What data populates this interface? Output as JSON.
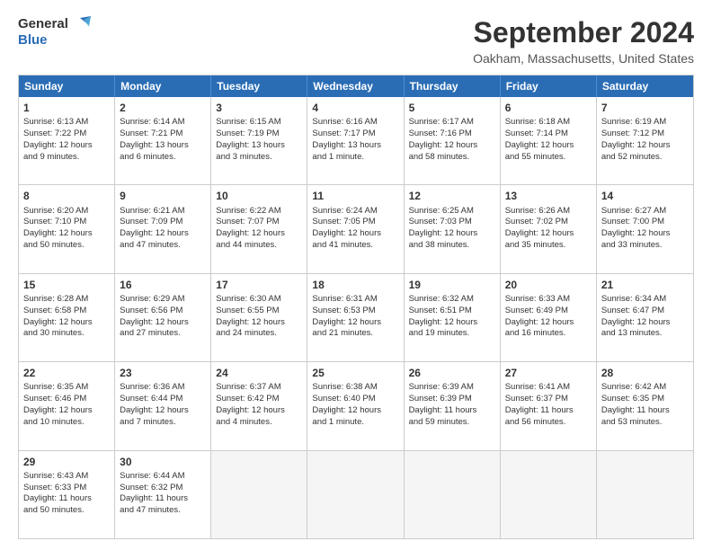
{
  "header": {
    "logo_line1": "General",
    "logo_line2": "Blue",
    "month": "September 2024",
    "location": "Oakham, Massachusetts, United States"
  },
  "weekdays": [
    "Sunday",
    "Monday",
    "Tuesday",
    "Wednesday",
    "Thursday",
    "Friday",
    "Saturday"
  ],
  "weeks": [
    [
      {
        "day": "1",
        "lines": [
          "Sunrise: 6:13 AM",
          "Sunset: 7:22 PM",
          "Daylight: 12 hours",
          "and 9 minutes."
        ]
      },
      {
        "day": "2",
        "lines": [
          "Sunrise: 6:14 AM",
          "Sunset: 7:21 PM",
          "Daylight: 13 hours",
          "and 6 minutes."
        ]
      },
      {
        "day": "3",
        "lines": [
          "Sunrise: 6:15 AM",
          "Sunset: 7:19 PM",
          "Daylight: 13 hours",
          "and 3 minutes."
        ]
      },
      {
        "day": "4",
        "lines": [
          "Sunrise: 6:16 AM",
          "Sunset: 7:17 PM",
          "Daylight: 13 hours",
          "and 1 minute."
        ]
      },
      {
        "day": "5",
        "lines": [
          "Sunrise: 6:17 AM",
          "Sunset: 7:16 PM",
          "Daylight: 12 hours",
          "and 58 minutes."
        ]
      },
      {
        "day": "6",
        "lines": [
          "Sunrise: 6:18 AM",
          "Sunset: 7:14 PM",
          "Daylight: 12 hours",
          "and 55 minutes."
        ]
      },
      {
        "day": "7",
        "lines": [
          "Sunrise: 6:19 AM",
          "Sunset: 7:12 PM",
          "Daylight: 12 hours",
          "and 52 minutes."
        ]
      }
    ],
    [
      {
        "day": "8",
        "lines": [
          "Sunrise: 6:20 AM",
          "Sunset: 7:10 PM",
          "Daylight: 12 hours",
          "and 50 minutes."
        ]
      },
      {
        "day": "9",
        "lines": [
          "Sunrise: 6:21 AM",
          "Sunset: 7:09 PM",
          "Daylight: 12 hours",
          "and 47 minutes."
        ]
      },
      {
        "day": "10",
        "lines": [
          "Sunrise: 6:22 AM",
          "Sunset: 7:07 PM",
          "Daylight: 12 hours",
          "and 44 minutes."
        ]
      },
      {
        "day": "11",
        "lines": [
          "Sunrise: 6:24 AM",
          "Sunset: 7:05 PM",
          "Daylight: 12 hours",
          "and 41 minutes."
        ]
      },
      {
        "day": "12",
        "lines": [
          "Sunrise: 6:25 AM",
          "Sunset: 7:03 PM",
          "Daylight: 12 hours",
          "and 38 minutes."
        ]
      },
      {
        "day": "13",
        "lines": [
          "Sunrise: 6:26 AM",
          "Sunset: 7:02 PM",
          "Daylight: 12 hours",
          "and 35 minutes."
        ]
      },
      {
        "day": "14",
        "lines": [
          "Sunrise: 6:27 AM",
          "Sunset: 7:00 PM",
          "Daylight: 12 hours",
          "and 33 minutes."
        ]
      }
    ],
    [
      {
        "day": "15",
        "lines": [
          "Sunrise: 6:28 AM",
          "Sunset: 6:58 PM",
          "Daylight: 12 hours",
          "and 30 minutes."
        ]
      },
      {
        "day": "16",
        "lines": [
          "Sunrise: 6:29 AM",
          "Sunset: 6:56 PM",
          "Daylight: 12 hours",
          "and 27 minutes."
        ]
      },
      {
        "day": "17",
        "lines": [
          "Sunrise: 6:30 AM",
          "Sunset: 6:55 PM",
          "Daylight: 12 hours",
          "and 24 minutes."
        ]
      },
      {
        "day": "18",
        "lines": [
          "Sunrise: 6:31 AM",
          "Sunset: 6:53 PM",
          "Daylight: 12 hours",
          "and 21 minutes."
        ]
      },
      {
        "day": "19",
        "lines": [
          "Sunrise: 6:32 AM",
          "Sunset: 6:51 PM",
          "Daylight: 12 hours",
          "and 19 minutes."
        ]
      },
      {
        "day": "20",
        "lines": [
          "Sunrise: 6:33 AM",
          "Sunset: 6:49 PM",
          "Daylight: 12 hours",
          "and 16 minutes."
        ]
      },
      {
        "day": "21",
        "lines": [
          "Sunrise: 6:34 AM",
          "Sunset: 6:47 PM",
          "Daylight: 12 hours",
          "and 13 minutes."
        ]
      }
    ],
    [
      {
        "day": "22",
        "lines": [
          "Sunrise: 6:35 AM",
          "Sunset: 6:46 PM",
          "Daylight: 12 hours",
          "and 10 minutes."
        ]
      },
      {
        "day": "23",
        "lines": [
          "Sunrise: 6:36 AM",
          "Sunset: 6:44 PM",
          "Daylight: 12 hours",
          "and 7 minutes."
        ]
      },
      {
        "day": "24",
        "lines": [
          "Sunrise: 6:37 AM",
          "Sunset: 6:42 PM",
          "Daylight: 12 hours",
          "and 4 minutes."
        ]
      },
      {
        "day": "25",
        "lines": [
          "Sunrise: 6:38 AM",
          "Sunset: 6:40 PM",
          "Daylight: 12 hours",
          "and 1 minute."
        ]
      },
      {
        "day": "26",
        "lines": [
          "Sunrise: 6:39 AM",
          "Sunset: 6:39 PM",
          "Daylight: 11 hours",
          "and 59 minutes."
        ]
      },
      {
        "day": "27",
        "lines": [
          "Sunrise: 6:41 AM",
          "Sunset: 6:37 PM",
          "Daylight: 11 hours",
          "and 56 minutes."
        ]
      },
      {
        "day": "28",
        "lines": [
          "Sunrise: 6:42 AM",
          "Sunset: 6:35 PM",
          "Daylight: 11 hours",
          "and 53 minutes."
        ]
      }
    ],
    [
      {
        "day": "29",
        "lines": [
          "Sunrise: 6:43 AM",
          "Sunset: 6:33 PM",
          "Daylight: 11 hours",
          "and 50 minutes."
        ]
      },
      {
        "day": "30",
        "lines": [
          "Sunrise: 6:44 AM",
          "Sunset: 6:32 PM",
          "Daylight: 11 hours",
          "and 47 minutes."
        ]
      },
      {
        "day": "",
        "lines": []
      },
      {
        "day": "",
        "lines": []
      },
      {
        "day": "",
        "lines": []
      },
      {
        "day": "",
        "lines": []
      },
      {
        "day": "",
        "lines": []
      }
    ]
  ]
}
